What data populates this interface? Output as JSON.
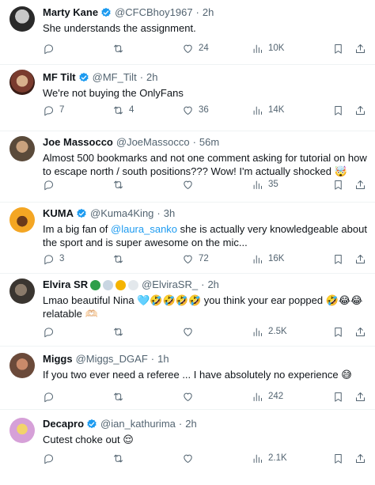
{
  "replies": [
    {
      "name": "Marty Kane",
      "verified": true,
      "handle": "@CFCBhoy1967",
      "time": "2h",
      "text": "She understands the assignment.",
      "replies": "",
      "reposts": "",
      "likes": "24",
      "views": "10K",
      "avatar_colors": [
        "#2a2a2a",
        "#c8c8c8"
      ]
    },
    {
      "name": "MF Tilt",
      "verified": true,
      "handle": "@MF_Tilt",
      "time": "2h",
      "text": "We're not buying the OnlyFans",
      "replies": "7",
      "reposts": "4",
      "likes": "36",
      "views": "14K",
      "avatar_colors": [
        "#7a3b2e",
        "#d8b08c"
      ]
    },
    {
      "name": "Joe Massocco",
      "verified": false,
      "handle": "@JoeMassocco",
      "time": "56m",
      "text": "Almost 500 bookmarks and not one comment asking for tutorial on how to escape north / south positions??? Wow! I'm actually shocked",
      "text_emoji": "🤯",
      "replies": "",
      "reposts": "",
      "likes": "",
      "views": "35",
      "avatar_colors": [
        "#5a4a3a",
        "#c9a27e"
      ]
    },
    {
      "name": "KUMA",
      "verified": true,
      "handle": "@Kuma4King",
      "time": "3h",
      "text_before": "Im a big fan of ",
      "mention": "@laura_sanko",
      "text_after": " she is actually very knowledgeable about the sport and is super awesome on the mic...",
      "replies": "3",
      "reposts": "",
      "likes": "72",
      "views": "16K",
      "avatar_colors": [
        "#f4a623",
        "#6b3a1a"
      ]
    },
    {
      "name": "Elvira SR",
      "verified": false,
      "handle": "@ElviraSR_",
      "time": "2h",
      "text": "Lmao beautiful Nina 🩵🤣🤣🤣🤣 you think your ear popped 🤣😂😂 relatable 🫶🏻",
      "replies": "",
      "reposts": "",
      "likes": "",
      "views": "2.5K",
      "avatar_colors": [
        "#3a3530",
        "#8a7a6a"
      ]
    },
    {
      "name": "Miggs",
      "verified": false,
      "handle": "@Miggs_DGAF",
      "time": "1h",
      "text": "If you two ever need a referee ... I have absolutely no experience",
      "text_emoji": "😅",
      "replies": "",
      "reposts": "",
      "likes": "",
      "views": "242",
      "avatar_colors": [
        "#6b4a3a",
        "#c98a6a"
      ]
    },
    {
      "name": "Decapro",
      "verified": true,
      "handle": "@ian_kathurima",
      "time": "2h",
      "text": "Cutest choke out",
      "text_emoji": "😌",
      "replies": "",
      "reposts": "",
      "likes": "",
      "views": "2.1K",
      "avatar_colors": [
        "#d6a0d8",
        "#f2d36b"
      ]
    }
  ],
  "colors": {
    "accent": "#1d9bf0",
    "muted": "#536471",
    "divider": "#eff3f4",
    "text": "#0f1419"
  }
}
